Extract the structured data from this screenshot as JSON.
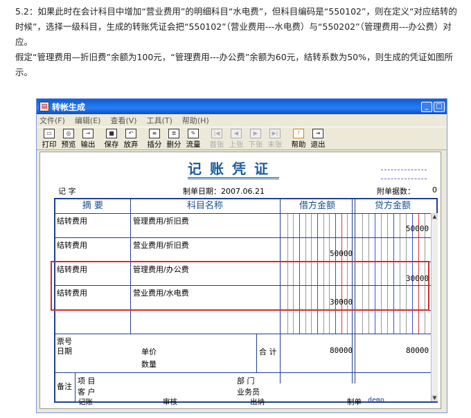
{
  "intro": {
    "p1": "5.2：如果此时在会计科目中增加“营业费用”的明细科目“水电费”，但科目编码是“550102”，则在定义“对应结转的时候”，选择一级科目，生成的转账凭证会把“550102”（营业费用---水电费）与“550202”（管理费用---办公费）对应。",
    "p2": "假定“管理费用—折旧费”余额为100元，“管理费用---办公费”余额为60元，结转系数为50%，则生成的凭证如图所示。"
  },
  "window": {
    "title": "转帐生成",
    "menu": [
      "文件(F)",
      "编辑(E)",
      "查看(V)",
      "工具(T)",
      "帮助(H)"
    ],
    "toolbar": [
      {
        "label": "打印",
        "icon": "print-icon",
        "enabled": true
      },
      {
        "label": "预览",
        "icon": "preview-icon",
        "enabled": true
      },
      {
        "label": "输出",
        "icon": "output-icon",
        "enabled": true
      },
      {
        "label": "保存",
        "icon": "save-icon",
        "enabled": true
      },
      {
        "label": "放弃",
        "icon": "undo-icon",
        "enabled": true
      },
      {
        "label": "插分",
        "icon": "insert-row-icon",
        "enabled": true
      },
      {
        "label": "删分",
        "icon": "delete-row-icon",
        "enabled": true
      },
      {
        "label": "流量",
        "icon": "flow-icon",
        "enabled": true
      },
      {
        "label": "首张",
        "icon": "first-icon",
        "enabled": false
      },
      {
        "label": "上张",
        "icon": "prev-icon",
        "enabled": false
      },
      {
        "label": "下张",
        "icon": "next-icon",
        "enabled": false
      },
      {
        "label": "末张",
        "icon": "last-icon",
        "enabled": false
      },
      {
        "label": "帮助",
        "icon": "help-icon",
        "enabled": true
      },
      {
        "label": "退出",
        "icon": "exit-icon",
        "enabled": true
      }
    ]
  },
  "voucher": {
    "title": "记账凭证",
    "type_label": "记 字",
    "date_label": "制单日期：2007.06.21",
    "attach_label": "附单据数：",
    "attach_count": "0",
    "headers": {
      "summary": "摘 要",
      "account": "科目名称",
      "debit": "借方金额",
      "credit": "贷方金额"
    },
    "rows": [
      {
        "summary": "结转费用",
        "account": "管理费用/折旧费",
        "debit": "",
        "credit": "50000"
      },
      {
        "summary": "结转费用",
        "account": "营业费用/折旧费",
        "debit": "50000",
        "credit": ""
      },
      {
        "summary": "结转费用",
        "account": "管理费用/办公费",
        "debit": "",
        "credit": "30000"
      },
      {
        "summary": "结转费用",
        "account": "营业费用/水电费",
        "debit": "30000",
        "credit": ""
      }
    ],
    "ticket_no_label": "票号",
    "date_row_label": "日期",
    "unit_price_label": "单价",
    "quantity_label": "数量",
    "total_label": "合 计",
    "total_debit": "80000",
    "total_credit": "80000",
    "remark_label": "备注",
    "project_label": "项 目",
    "customer_label": "客 户",
    "dept_label": "部 门",
    "salesperson_label": "业务员",
    "footer": {
      "bookkeep": "记账",
      "audit": "审核",
      "cashier": "出纳",
      "maker": "制单",
      "maker_name": "demo"
    }
  },
  "colors": {
    "highlight": "#d62a2a",
    "grid_blue": "#3355cc",
    "grid_red": "#e03030",
    "title_blue": "#1a5c9e"
  }
}
